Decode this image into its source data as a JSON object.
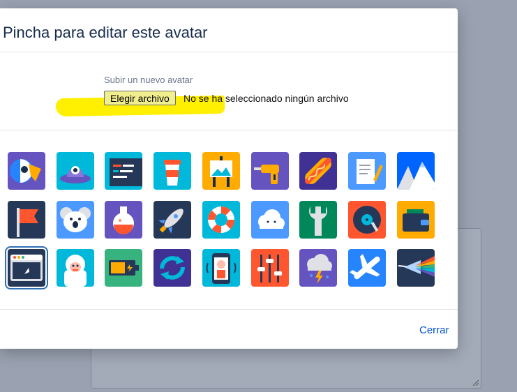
{
  "dialog": {
    "title": "Pincha para editar este avatar",
    "upload_label": "Subir un nuevo avatar",
    "file_button": "Elegir archivo",
    "file_status": "No se ha seleccionado ningún archivo",
    "close_label": "Cerrar"
  },
  "avatars": {
    "selected_index": 18,
    "items": [
      {
        "name": "parrot-avatar-icon"
      },
      {
        "name": "ufo-avatar-icon"
      },
      {
        "name": "code-window-avatar-icon"
      },
      {
        "name": "coffee-cup-avatar-icon"
      },
      {
        "name": "easel-avatar-icon"
      },
      {
        "name": "drill-avatar-icon"
      },
      {
        "name": "hot-dog-avatar-icon"
      },
      {
        "name": "notepad-pencil-avatar-icon"
      },
      {
        "name": "mountains-avatar-icon"
      },
      {
        "name": "red-flag-avatar-icon"
      },
      {
        "name": "koala-avatar-icon"
      },
      {
        "name": "potion-flask-avatar-icon"
      },
      {
        "name": "rocket-avatar-icon"
      },
      {
        "name": "life-ring-avatar-icon"
      },
      {
        "name": "cloud-avatar-icon"
      },
      {
        "name": "wrench-avatar-icon"
      },
      {
        "name": "vinyl-record-avatar-icon"
      },
      {
        "name": "wallet-avatar-icon"
      },
      {
        "name": "browser-cursor-avatar-icon"
      },
      {
        "name": "yeti-avatar-icon"
      },
      {
        "name": "battery-avatar-icon"
      },
      {
        "name": "refresh-arrows-avatar-icon"
      },
      {
        "name": "phone-selfie-avatar-icon"
      },
      {
        "name": "equalizer-sliders-avatar-icon"
      },
      {
        "name": "storm-cloud-avatar-icon"
      },
      {
        "name": "airplane-avatar-icon"
      },
      {
        "name": "prism-avatar-icon"
      }
    ]
  },
  "colors": {
    "overlay": "#9aa1b0",
    "title": "#172b4d",
    "link": "#0052cc",
    "highlight": "#ffef00",
    "selected_outline": "#2f6fb3"
  }
}
